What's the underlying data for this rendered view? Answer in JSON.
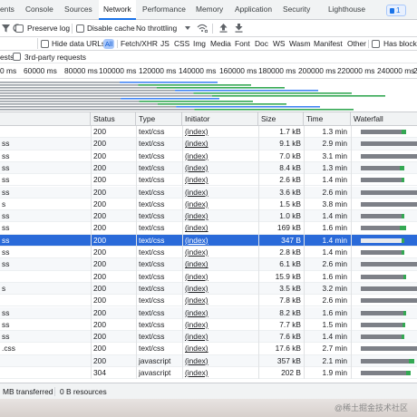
{
  "tabs": {
    "elements": "ents",
    "console": "Console",
    "sources": "Sources",
    "network": "Network",
    "performance": "Performance",
    "memory": "Memory",
    "application": "Application",
    "security": "Security",
    "lighthouse": "Lighthouse",
    "issues_count": "1",
    "more_label": ">>"
  },
  "toolbar": {
    "preserve_log": "Preserve log",
    "disable_cache": "Disable cache",
    "throttling": "No throttling"
  },
  "filters": {
    "hide_data_urls": "Hide data URLs",
    "all": "All",
    "types": [
      "Fetch/XHR",
      "JS",
      "CSS",
      "Img",
      "Media",
      "Font",
      "Doc",
      "WS",
      "Wasm",
      "Manifest",
      "Other"
    ],
    "has_blocked": "Has blocke"
  },
  "row3": {
    "ests": "ests",
    "third_party": "3rd-party requests"
  },
  "ruler": [
    "0 ms",
    "60000 ms",
    "80000 ms",
    "100000 ms",
    "120000 ms",
    "140000 ms",
    "160000 ms",
    "180000 ms",
    "200000 ms",
    "220000 ms",
    "240000 ms",
    "2"
  ],
  "columns": {
    "status": "Status",
    "type": "Type",
    "initiator": "Initiator",
    "size": "Size",
    "time": "Time",
    "waterfall": "Waterfall"
  },
  "rows": [
    {
      "name": "",
      "status": "200",
      "type": "text/css",
      "initiator": "(index)",
      "size": "1.7 kB",
      "time": "1.3 min",
      "wait": 0.72,
      "dl": 0.09
    },
    {
      "name": "ss",
      "status": "200",
      "type": "text/css",
      "initiator": "(index)",
      "size": "9.1 kB",
      "time": "2.9 min",
      "wait": 1.0,
      "dl": 0
    },
    {
      "name": "ss",
      "status": "200",
      "type": "text/css",
      "initiator": "(index)",
      "size": "7.0 kB",
      "time": "3.1 min",
      "wait": 1.0,
      "dl": 0
    },
    {
      "name": "ss",
      "status": "200",
      "type": "text/css",
      "initiator": "(index)",
      "size": "8.4 kB",
      "time": "1.3 min",
      "wait": 0.7,
      "dl": 0.07
    },
    {
      "name": "ss",
      "status": "200",
      "type": "text/css",
      "initiator": "(index)",
      "size": "2.6 kB",
      "time": "1.4 min",
      "wait": 0.72,
      "dl": 0.06
    },
    {
      "name": "ss",
      "status": "200",
      "type": "text/css",
      "initiator": "(index)",
      "size": "3.6 kB",
      "time": "2.6 min",
      "wait": 1.0,
      "dl": 0
    },
    {
      "name": "s",
      "status": "200",
      "type": "text/css",
      "initiator": "(index)",
      "size": "1.5 kB",
      "time": "3.8 min",
      "wait": 1.0,
      "dl": 0
    },
    {
      "name": "ss",
      "status": "200",
      "type": "text/css",
      "initiator": "(index)",
      "size": "1.0 kB",
      "time": "1.4 min",
      "wait": 0.72,
      "dl": 0.05
    },
    {
      "name": "ss",
      "status": "200",
      "type": "text/css",
      "initiator": "(index)",
      "size": "169 kB",
      "time": "1.6 min",
      "wait": 0.7,
      "dl": 0.1
    },
    {
      "name": "ss",
      "status": "200",
      "type": "text/css",
      "initiator": "(index)",
      "size": "347 B",
      "time": "1.4 min",
      "wait": 0.72,
      "dl": 0.06,
      "selected": true
    },
    {
      "name": "ss",
      "status": "200",
      "type": "text/css",
      "initiator": "(index)",
      "size": "2.8 kB",
      "time": "1.4 min",
      "wait": 0.72,
      "dl": 0.05
    },
    {
      "name": "ss",
      "status": "200",
      "type": "text/css",
      "initiator": "(index)",
      "size": "6.1 kB",
      "time": "2.6 min",
      "wait": 1.0,
      "dl": 0
    },
    {
      "name": "",
      "status": "200",
      "type": "text/css",
      "initiator": "(index)",
      "size": "15.9 kB",
      "time": "1.6 min",
      "wait": 0.75,
      "dl": 0.06
    },
    {
      "name": "s",
      "status": "200",
      "type": "text/css",
      "initiator": "(index)",
      "size": "3.5 kB",
      "time": "3.2 min",
      "wait": 1.0,
      "dl": 0
    },
    {
      "name": "",
      "status": "200",
      "type": "text/css",
      "initiator": "(index)",
      "size": "7.8 kB",
      "time": "2.6 min",
      "wait": 1.0,
      "dl": 0
    },
    {
      "name": "ss",
      "status": "200",
      "type": "text/css",
      "initiator": "(index)",
      "size": "8.2 kB",
      "time": "1.6 min",
      "wait": 0.75,
      "dl": 0.05
    },
    {
      "name": "ss",
      "status": "200",
      "type": "text/css",
      "initiator": "(index)",
      "size": "7.7 kB",
      "time": "1.5 min",
      "wait": 0.74,
      "dl": 0.05
    },
    {
      "name": "ss",
      "status": "200",
      "type": "text/css",
      "initiator": "(index)",
      "size": "7.6 kB",
      "time": "1.4 min",
      "wait": 0.72,
      "dl": 0.05
    },
    {
      "name": ".css",
      "status": "200",
      "type": "text/css",
      "initiator": "(index)",
      "size": "17.6 kB",
      "time": "2.7 min",
      "wait": 1.0,
      "dl": 0
    },
    {
      "name": "",
      "status": "200",
      "type": "javascript",
      "initiator": "(index)",
      "size": "357 kB",
      "time": "2.1 min",
      "wait": 0.85,
      "dl": 0.1
    },
    {
      "name": "",
      "status": "304",
      "type": "javascript",
      "initiator": "(index)",
      "size": "202 B",
      "time": "1.9 min",
      "wait": 0.8,
      "dl": 0.09
    }
  ],
  "status": {
    "transferred": "MB transferred",
    "resources": "0 B resources"
  },
  "watermark": "@稀土掘金技术社区",
  "colors": {
    "accent": "#1a73e8",
    "selected_row": "#2a6ad9",
    "wait_bar": "#7d8087",
    "download_bar": "#34a853"
  }
}
